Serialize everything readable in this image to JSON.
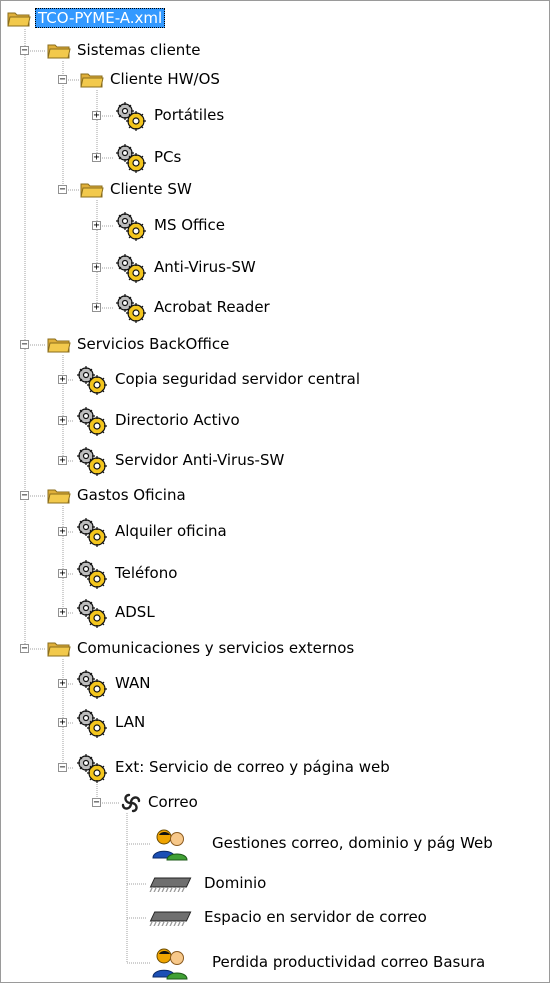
{
  "tree": {
    "nodes": [
      {
        "id": "root",
        "depth": 0,
        "label": "TCO-PYME-A.xml",
        "icon": "folder-open-icon",
        "selected": true
      },
      {
        "id": "n1",
        "depth": 1,
        "label": "Sistemas cliente",
        "icon": "folder-open-icon",
        "expander": "minus"
      },
      {
        "id": "n2",
        "depth": 2,
        "label": "Cliente HW/OS",
        "icon": "folder-open-icon",
        "expander": "minus"
      },
      {
        "id": "n3",
        "depth": 3,
        "label": "Portátiles",
        "icon": "gears-icon",
        "expander": "plus"
      },
      {
        "id": "n4",
        "depth": 3,
        "label": "PCs",
        "icon": "gears-icon",
        "expander": "plus"
      },
      {
        "id": "n5",
        "depth": 2,
        "label": "Cliente SW",
        "icon": "folder-open-icon",
        "expander": "minus"
      },
      {
        "id": "n6",
        "depth": 3,
        "label": "MS Office",
        "icon": "gears-icon",
        "expander": "plus"
      },
      {
        "id": "n7",
        "depth": 3,
        "label": "Anti-Virus-SW",
        "icon": "gears-icon",
        "expander": "plus"
      },
      {
        "id": "n8",
        "depth": 3,
        "label": "Acrobat Reader",
        "icon": "gears-icon",
        "expander": "plus"
      },
      {
        "id": "n9",
        "depth": 1,
        "label": "Servicios BackOffice",
        "icon": "folder-open-icon",
        "expander": "minus"
      },
      {
        "id": "n10",
        "depth": 2,
        "label": "Copia seguridad servidor central",
        "icon": "gears-icon",
        "expander": "plus"
      },
      {
        "id": "n11",
        "depth": 2,
        "label": "Directorio Activo",
        "icon": "gears-icon",
        "expander": "plus"
      },
      {
        "id": "n12",
        "depth": 2,
        "label": "Servidor  Anti-Virus-SW",
        "icon": "gears-icon",
        "expander": "plus"
      },
      {
        "id": "n13",
        "depth": 1,
        "label": "Gastos Oficina",
        "icon": "folder-open-icon",
        "expander": "minus"
      },
      {
        "id": "n14",
        "depth": 2,
        "label": "Alquiler oficina",
        "icon": "gears-icon",
        "expander": "plus"
      },
      {
        "id": "n15",
        "depth": 2,
        "label": "Teléfono",
        "icon": "gears-icon",
        "expander": "plus"
      },
      {
        "id": "n16",
        "depth": 2,
        "label": "ADSL",
        "icon": "gears-icon",
        "expander": "plus"
      },
      {
        "id": "n17",
        "depth": 1,
        "label": "Comunicaciones y servicios externos",
        "icon": "folder-open-icon",
        "expander": "minus"
      },
      {
        "id": "n18",
        "depth": 2,
        "label": "WAN",
        "icon": "gears-icon",
        "expander": "plus"
      },
      {
        "id": "n19",
        "depth": 2,
        "label": "LAN",
        "icon": "gears-icon",
        "expander": "plus"
      },
      {
        "id": "n20",
        "depth": 2,
        "label": "Ext: Servicio de correo y página web",
        "icon": "gears-icon",
        "expander": "minus"
      },
      {
        "id": "n21",
        "depth": 3,
        "label": "Correo",
        "icon": "swirl-icon",
        "expander": "minus"
      },
      {
        "id": "n22",
        "depth": 4,
        "label": "Gestiones correo, dominio y pág Web",
        "icon": "people-icon"
      },
      {
        "id": "n23",
        "depth": 4,
        "label": "Dominio",
        "icon": "memory-chip-icon"
      },
      {
        "id": "n24",
        "depth": 4,
        "label": "Espacio en servidor de correo",
        "icon": "memory-chip-icon"
      },
      {
        "id": "n25",
        "depth": 4,
        "label": "Perdida productividad correo Basura",
        "icon": "people-icon"
      }
    ]
  },
  "colors": {
    "selection": "#3399ff",
    "folder": "#f2c94c",
    "tree_lines": "#a0a0a0"
  }
}
